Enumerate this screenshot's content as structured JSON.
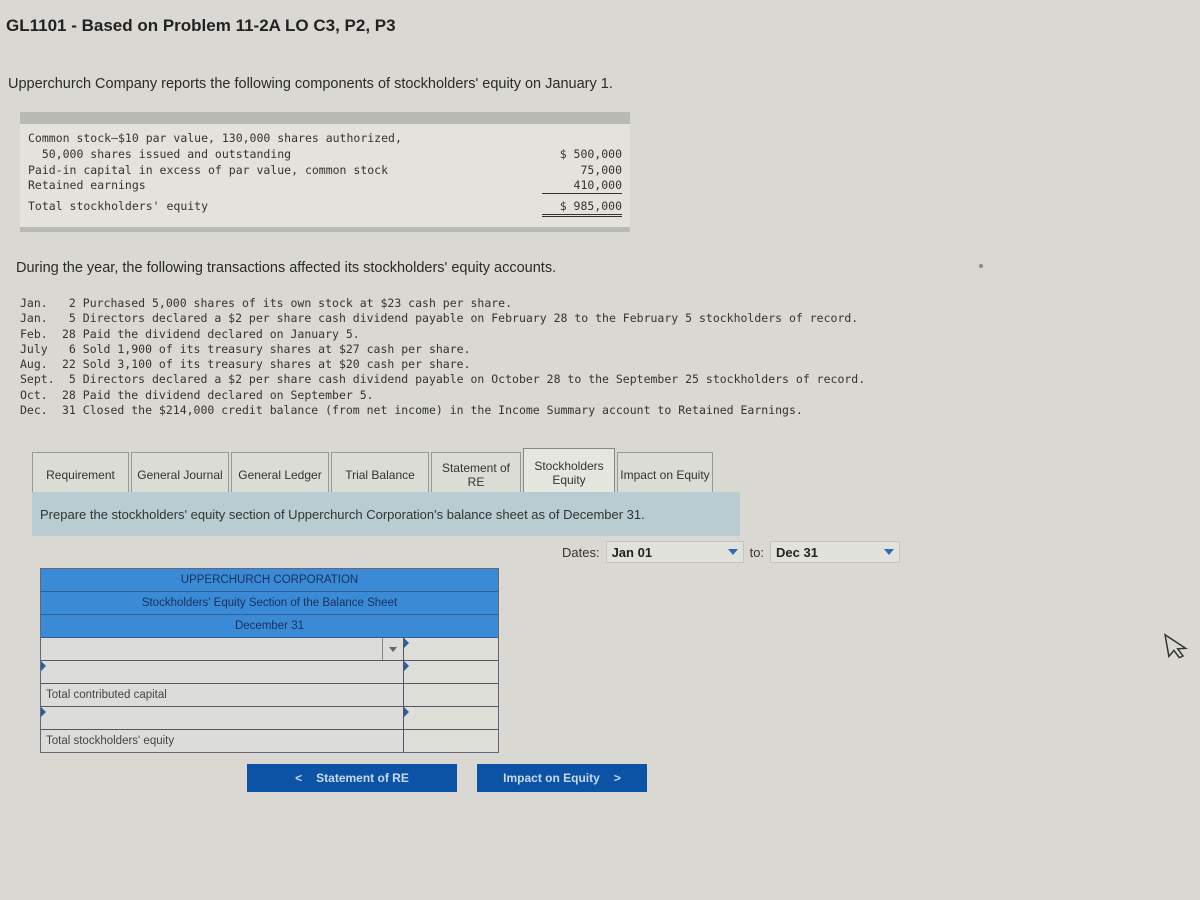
{
  "title": "GL1101 - Based on Problem 11-2A LO C3, P2, P3",
  "intro": "Upperchurch Company reports the following components of stockholders' equity on January 1.",
  "opening_equity": {
    "rows": [
      {
        "label": "Common stock—$10 par value, 130,000 shares authorized,",
        "amount": ""
      },
      {
        "label": "  50,000 shares issued and outstanding",
        "amount": "$ 500,000"
      },
      {
        "label": "Paid-in capital in excess of par value, common stock",
        "amount": "75,000"
      },
      {
        "label": "Retained earnings",
        "amount": "410,000"
      }
    ],
    "total": {
      "label": "Total stockholders' equity",
      "amount": "$ 985,000"
    }
  },
  "during_text": "During the year, the following transactions affected its stockholders' equity accounts.",
  "transactions": [
    {
      "month": "Jan.",
      "text": " 2 Purchased 5,000 shares of its own stock at $23 cash per share."
    },
    {
      "month": "Jan.",
      "text": " 5 Directors declared a $2 per share cash dividend payable on February 28 to the February 5 stockholders of record."
    },
    {
      "month": "Feb.",
      "text": "28 Paid the dividend declared on January 5."
    },
    {
      "month": "July",
      "text": " 6 Sold 1,900 of its treasury shares at $27 cash per share."
    },
    {
      "month": "Aug.",
      "text": "22 Sold 3,100 of its treasury shares at $20 cash per share."
    },
    {
      "month": "Sept.",
      "text": " 5 Directors declared a $2 per share cash dividend payable on October 28 to the September 25 stockholders of record."
    },
    {
      "month": "Oct.",
      "text": "28 Paid the dividend declared on September 5."
    },
    {
      "month": "Dec.",
      "text": "31 Closed the $214,000 credit balance (from net income) in the Income Summary account to Retained Earnings."
    }
  ],
  "tabs": [
    {
      "label": "Requirement",
      "active": false
    },
    {
      "label": "General Journal",
      "active": false
    },
    {
      "label": "General Ledger",
      "active": false
    },
    {
      "label": "Trial Balance",
      "active": false
    },
    {
      "label": "Statement of RE",
      "active": false
    },
    {
      "label": "Stockholders Equity",
      "active": true
    },
    {
      "label": "Impact on Equity",
      "active": false
    }
  ],
  "instruction": "Prepare the stockholders' equity section of Upperchurch Corporation's balance sheet as of December 31.",
  "dates": {
    "label": "Dates:",
    "from": "Jan 01",
    "to_label": "to:",
    "to": "Dec 31"
  },
  "balance_sheet": {
    "company": "UPPERCHURCH CORPORATION",
    "subtitle": "Stockholders' Equity Section of the Balance Sheet",
    "date": "December 31",
    "rows": [
      {
        "label": "",
        "value": "",
        "type": "select"
      },
      {
        "label": "",
        "value": "",
        "type": "input"
      },
      {
        "label": "Total contributed capital",
        "value": "",
        "type": "static"
      },
      {
        "label": "",
        "value": "",
        "type": "input"
      },
      {
        "label": "Total stockholders' equity",
        "value": "",
        "type": "static"
      }
    ]
  },
  "nav": {
    "prev": "Statement of RE",
    "next": "Impact on Equity"
  },
  "colors": {
    "nav_button": "#0c52a5",
    "header_blue": "#3b8ad6",
    "instruction_bar": "#b7cdd1"
  }
}
